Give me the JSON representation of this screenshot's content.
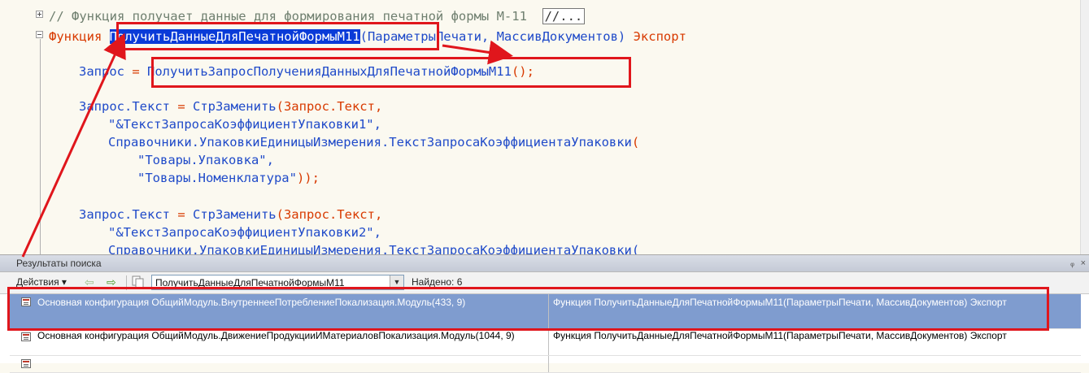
{
  "editor": {
    "comment": "// Функция получает данные для формирования печатной формы М-11",
    "collapsed_marker": "//...",
    "func_keyword": "Функция",
    "func_name": "ПолучитьДанныеДляПечатнойФормыМ11",
    "func_params": "(ПараметрыПечати, МассивДокументов)",
    "func_export": "Экспорт",
    "line3_var": "Запрос",
    "line3_eq": " = ",
    "line3_call": "ПолучитьЗапросПолученияДанныхДляПечатнойФормыМ11",
    "line3_tail": "();",
    "line4_a": "Запрос.Текст",
    "line4_b": " = ",
    "line4_c": "СтрЗаменить",
    "line4_d": "(Запрос.Текст,",
    "line5": "\"&ТекстЗапросаКоэффициентУпаковки1\",",
    "line6_a": "Справочники.УпаковкиЕдиницыИзмерения.ТекстЗапросаКоэффициентаУпаковки",
    "line6_b": "(",
    "line7": "\"Товары.Упаковка\",",
    "line8_a": "\"Товары.Номенклатура\"",
    "line8_b": "));",
    "line9_a": "Запрос.Текст",
    "line9_b": " = ",
    "line9_c": "СтрЗаменить",
    "line9_d": "(Запрос.Текст,",
    "line10": "\"&ТекстЗапросаКоэффициентУпаковки2\",",
    "line11": "Справочники.УпаковкиЕдиницыИзмерения.ТекстЗапросаКоэффициентаУпаковки("
  },
  "search_panel": {
    "title": "Результаты поиска",
    "pin": "ᵩ",
    "close": "×",
    "actions_label": "Действия",
    "query": "ПолучитьДанныеДляПечатнойФормыМ11",
    "found": "Найдено: 6",
    "rows": [
      {
        "location": "Основная конфигурация ОбщийМодуль.ВнутреннееПотреблениеПокализация.Модуль(433, 9)",
        "text": "Функция ПолучитьДанныеДляПечатнойФормыМ11(ПараметрыПечати, МассивДокументов) Экспорт"
      },
      {
        "location": "Основная конфигурация ОбщийМодуль.ДвижениеПродукцииИМатериаловПокализация.Модуль(1044, 9)",
        "text": "Функция ПолучитьДанныеДляПечатнойФормыМ11(ПараметрыПечати, МассивДокументов) Экспорт"
      }
    ]
  },
  "colors": {
    "highlight": "#0a3bd8",
    "annotation_red": "#e0161c",
    "selected_row": "#7f9ccf"
  }
}
